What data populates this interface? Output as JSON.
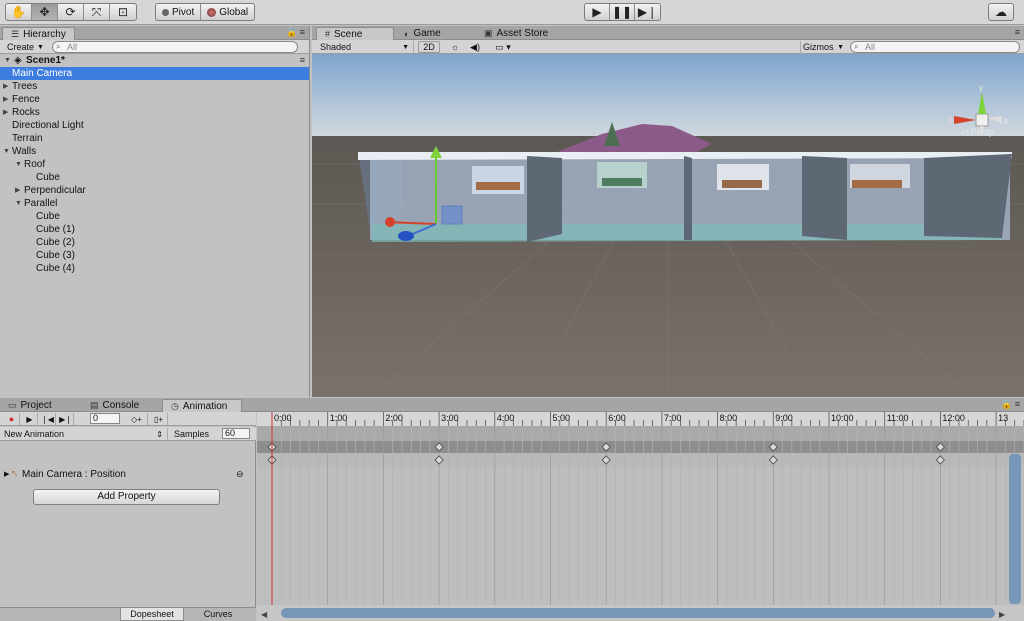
{
  "toolbar": {
    "pivot_label": "Pivot",
    "global_label": "Global"
  },
  "hierarchy": {
    "tab_label": "Hierarchy",
    "create_label": "Create",
    "search_placeholder": "All",
    "scene_name": "Scene1*",
    "items": [
      {
        "label": "Main Camera",
        "depth": 1,
        "arrow": "none",
        "selected": true
      },
      {
        "label": "Trees",
        "depth": 1,
        "arrow": "collapsed"
      },
      {
        "label": "Fence",
        "depth": 1,
        "arrow": "collapsed"
      },
      {
        "label": "Rocks",
        "depth": 1,
        "arrow": "collapsed"
      },
      {
        "label": "Directional Light",
        "depth": 1,
        "arrow": "none"
      },
      {
        "label": "Terrain",
        "depth": 1,
        "arrow": "none"
      },
      {
        "label": "Walls",
        "depth": 1,
        "arrow": "expanded"
      },
      {
        "label": "Roof",
        "depth": 2,
        "arrow": "expanded"
      },
      {
        "label": "Cube",
        "depth": 3,
        "arrow": "none"
      },
      {
        "label": "Perpendicular",
        "depth": 2,
        "arrow": "collapsed"
      },
      {
        "label": "Parallel",
        "depth": 2,
        "arrow": "expanded"
      },
      {
        "label": "Cube",
        "depth": 3,
        "arrow": "none"
      },
      {
        "label": "Cube (1)",
        "depth": 3,
        "arrow": "none"
      },
      {
        "label": "Cube (2)",
        "depth": 3,
        "arrow": "none"
      },
      {
        "label": "Cube (3)",
        "depth": 3,
        "arrow": "none"
      },
      {
        "label": "Cube (4)",
        "depth": 3,
        "arrow": "none"
      }
    ]
  },
  "scene": {
    "tabs": [
      "Scene",
      "Game",
      "Asset Store"
    ],
    "shading_mode": "Shaded",
    "mode_2d": "2D",
    "gizmos_label": "Gizmos",
    "search_placeholder": "All",
    "camera_label": "◁ Persp",
    "gizmo_axes": [
      "y",
      "x",
      "z"
    ]
  },
  "bottom": {
    "tabs": [
      "Project",
      "Console",
      "Animation"
    ],
    "frame_value": "0",
    "clip_name": "New Animation",
    "samples_label": "Samples",
    "samples_value": "60",
    "property_label": "Main Camera : Position",
    "add_property_label": "Add Property",
    "view_tabs": [
      "Dopesheet",
      "Curves"
    ],
    "time_labels": [
      "0:00",
      "1:00",
      "2:00",
      "3:00",
      "4:00",
      "5:00",
      "6:00",
      "7:00",
      "8:00",
      "9:00",
      "10:00",
      "11:00",
      "12:00",
      "13"
    ],
    "keyframe_times": [
      "0:00",
      "3:00",
      "6:00",
      "9:00",
      "12:00"
    ]
  },
  "colors": {
    "selection": "#3e7de0",
    "playhead": "#d03030",
    "sky_top": "#8fb3d6",
    "ground": "#6f6761"
  }
}
